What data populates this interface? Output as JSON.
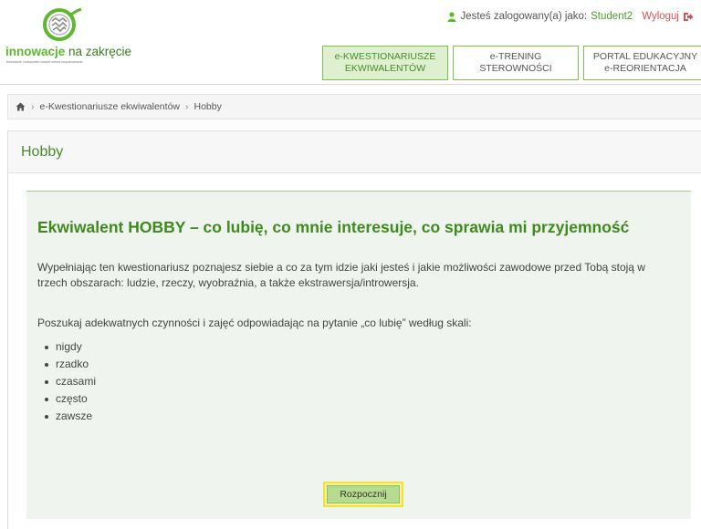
{
  "header": {
    "logo_brand": "innowacje",
    "logo_suffix": "na zakręcie",
    "logo_tagline": "testowanie i wdrażanie nowych metod rozpoznawania",
    "user_prefix": "Jesteś zalogowany(a) jako:",
    "username": "Student2",
    "logout_label": "Wyloguj",
    "colors": {
      "brand_green": "#5cb82e",
      "dark_green": "#3f8a1f",
      "logout_red": "#d9534f"
    }
  },
  "nav": {
    "items": [
      {
        "line1": "e-KWESTIONARIUSZE",
        "line2": "EKWIWALENTÓW",
        "active": true
      },
      {
        "line1": "e-TRENING",
        "line2": "STEROWNOŚCI",
        "active": false
      },
      {
        "line1": "PORTAL EDUKACYJNY",
        "line2": "e-REORIENTACJA",
        "active": false
      }
    ]
  },
  "breadcrumb": {
    "home_icon": "home-icon",
    "items": [
      "e-Kwestionariusze ekwiwalentów",
      "Hobby"
    ]
  },
  "panel": {
    "title": "Hobby"
  },
  "content": {
    "heading": "Ekwiwalent HOBBY – co lubię, co mnie interesuje, co sprawia mi przyjemność",
    "paragraph1": "Wypełniając ten kwestionariusz poznajesz siebie a co za tym idzie jaki jesteś i jakie możliwości zawodowe przed Tobą stoją w trzech obszarach: ludzie, rzeczy, wyobraźnia, a także ekstrawersja/introwersja.",
    "paragraph2": "Poszukaj adekwatnych czynności i zajęć odpowiadając na pytanie „co lubię” według skali:",
    "scale": [
      "nigdy",
      "rzadko",
      "czasami",
      "często",
      "zawsze"
    ],
    "start_label": "Rozpocznij"
  }
}
